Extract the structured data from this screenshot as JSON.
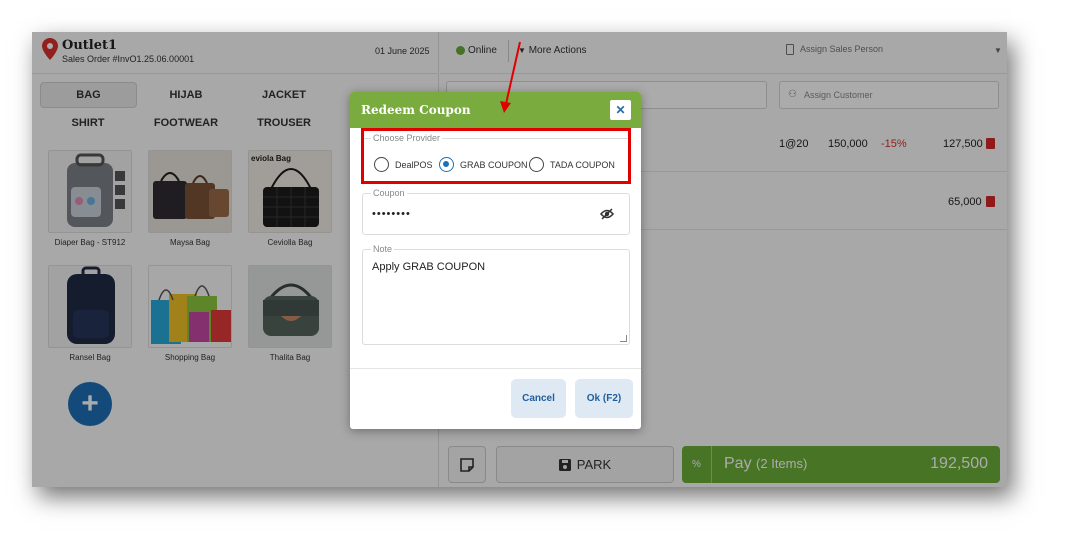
{
  "outlet": {
    "name": "Outlet1",
    "order_no": "Sales Order #InvO1.25.06.00001",
    "date": "01 June 2025"
  },
  "status": {
    "online": "Online",
    "more_actions": "More Actions",
    "assign_sales_person": "Assign Sales Person"
  },
  "customer": {
    "placeholder": "Assign Customer"
  },
  "categories": [
    "BAG",
    "HIJAB",
    "JACKET",
    "SHIRT",
    "FOOTWEAR",
    "TROUSER"
  ],
  "products": [
    {
      "name": "Diaper Bag - ST912",
      "icon": "backpack-gray"
    },
    {
      "name": "Maysa Bag",
      "icon": "handbags-group"
    },
    {
      "name": "Ceviolla Bag",
      "icon": "quilted-black-bag",
      "thumb_text": "eviola Bag"
    },
    {
      "name": "Ransel Bag",
      "icon": "backpack-navy"
    },
    {
      "name": "Shopping Bag",
      "icon": "shopping-bags"
    },
    {
      "name": "Thalita Bag",
      "icon": "green-shoulder-bag"
    }
  ],
  "cart": [
    {
      "qty_price": "1@20",
      "price": "150,000",
      "discount": "-15%",
      "total": "127,500"
    },
    {
      "qty_price": "",
      "price": "",
      "discount": "",
      "total": "65,000"
    }
  ],
  "bottom": {
    "park": "PARK",
    "pay_label": "Pay",
    "pay_items": "(2 Items)",
    "pay_total": "192,500",
    "pct": "%"
  },
  "modal": {
    "title": "Redeem Coupon",
    "close": "✕",
    "provider_legend": "Choose Provider",
    "providers": [
      {
        "label": "DealPOS",
        "selected": false
      },
      {
        "label": "GRAB COUPON",
        "selected": true
      },
      {
        "label": "TADA COUPON",
        "selected": false
      }
    ],
    "coupon_legend": "Coupon",
    "coupon_value": "••••••••",
    "note_legend": "Note",
    "note_value": "Apply GRAB COUPON",
    "cancel": "Cancel",
    "ok": "Ok (F2)"
  },
  "colors": {
    "accent_green": "#7aab3f",
    "pay_green": "#6cae3a",
    "primary_blue": "#1f6fb5",
    "highlight_red": "#e00000",
    "trash_red": "#d62828"
  }
}
